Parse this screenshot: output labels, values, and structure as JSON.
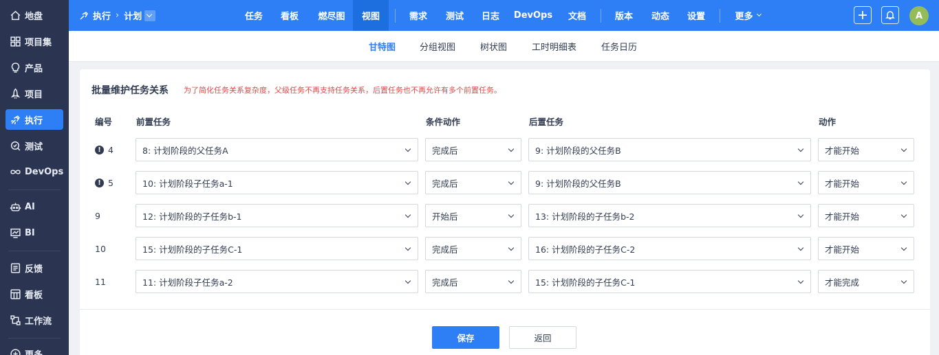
{
  "sidebar": {
    "items": [
      {
        "label": "地盘",
        "icon": "home-icon",
        "active": false
      },
      {
        "label": "项目集",
        "icon": "grid-icon",
        "active": false
      },
      {
        "label": "产品",
        "icon": "lightbulb-icon",
        "active": false
      },
      {
        "label": "项目",
        "icon": "rocket-icon",
        "active": false
      },
      {
        "label": "执行",
        "icon": "run-icon",
        "active": true
      },
      {
        "label": "测试",
        "icon": "test-icon",
        "active": false
      },
      {
        "label": "DevOps",
        "icon": "infinity-icon",
        "active": false
      },
      {
        "label": "AI",
        "icon": "robot-icon",
        "active": false
      },
      {
        "label": "BI",
        "icon": "chart-icon",
        "active": false
      },
      {
        "label": "反馈",
        "icon": "feedback-icon",
        "active": false
      },
      {
        "label": "看板",
        "icon": "kanban-icon",
        "active": false
      },
      {
        "label": "工作流",
        "icon": "workflow-icon",
        "active": false
      },
      {
        "label": "更多",
        "icon": "more-icon",
        "active": false
      }
    ]
  },
  "topbar": {
    "breadcrumb": {
      "section": "执行",
      "page": "计划"
    },
    "nav": [
      "任务",
      "看板",
      "燃尽图",
      "视图",
      "需求",
      "测试",
      "日志",
      "DevOps",
      "文档",
      "版本",
      "动态",
      "设置",
      "更多"
    ],
    "active_nav": "视图",
    "avatar": "A"
  },
  "subnav": {
    "tabs": [
      "甘特图",
      "分组视图",
      "树状图",
      "工时明细表",
      "任务日历"
    ],
    "active": "甘特图"
  },
  "panel": {
    "title": "批量维护任务关系",
    "note": "为了简化任务关系复杂度，父级任务不再支持任务关系，后置任务也不再允许有多个前置任务。",
    "headers": {
      "id": "编号",
      "pre": "前置任务",
      "condition": "条件动作",
      "post": "后置任务",
      "action": "动作"
    },
    "rows": [
      {
        "id": "4",
        "warning": true,
        "pre": "8: 计划阶段的父任务A",
        "condition": "完成后",
        "post": "9: 计划阶段的父任务B",
        "action": "才能开始"
      },
      {
        "id": "5",
        "warning": true,
        "pre": "10: 计划阶段子任务a-1",
        "condition": "完成后",
        "post": "9: 计划阶段的父任务B",
        "action": "才能开始"
      },
      {
        "id": "9",
        "warning": false,
        "pre": "12: 计划阶段的子任务b-1",
        "condition": "开始后",
        "post": "13: 计划阶段的子任务b-2",
        "action": "才能开始"
      },
      {
        "id": "10",
        "warning": false,
        "pre": "15: 计划阶段的子任务C-1",
        "condition": "完成后",
        "post": "16: 计划阶段的子任务C-2",
        "action": "才能开始"
      },
      {
        "id": "11",
        "warning": false,
        "pre": "11: 计划阶段子任务a-2",
        "condition": "完成后",
        "post": "15: 计划阶段的子任务C-1",
        "action": "才能完成"
      }
    ],
    "save_label": "保存",
    "back_label": "返回"
  }
}
